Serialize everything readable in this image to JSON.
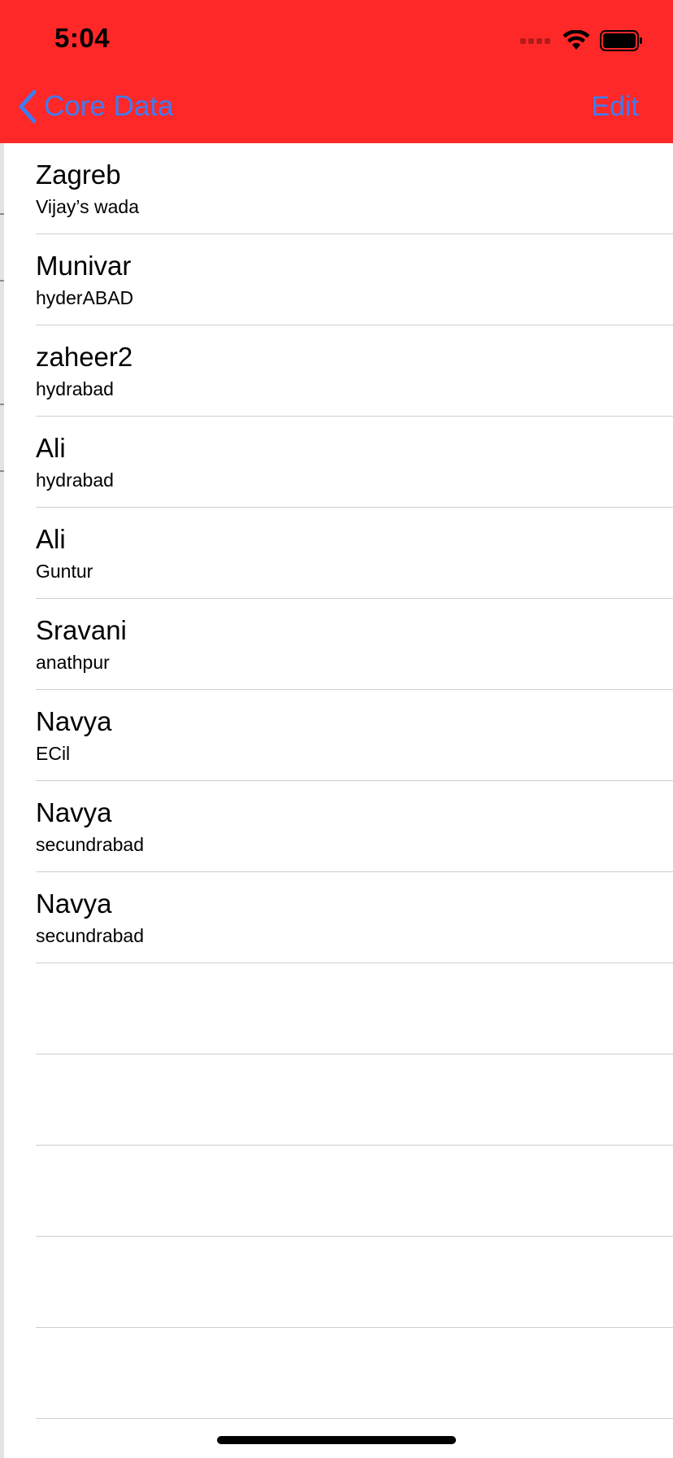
{
  "status_bar": {
    "time": "5:04"
  },
  "nav_bar": {
    "back_label": "Core Data",
    "edit_label": "Edit",
    "background_color": "#fe2828",
    "tint_color": "#3f7cf0"
  },
  "rows": [
    {
      "title": "Zagreb",
      "subtitle": "Vijay’s wada"
    },
    {
      "title": "Munivar",
      "subtitle": "hyderABAD"
    },
    {
      "title": "zaheer2",
      "subtitle": "hydrabad"
    },
    {
      "title": "Ali",
      "subtitle": "hydrabad"
    },
    {
      "title": "Ali",
      "subtitle": "Guntur"
    },
    {
      "title": "Sravani",
      "subtitle": "anathpur"
    },
    {
      "title": "Navya",
      "subtitle": "ECil"
    },
    {
      "title": "Navya",
      "subtitle": "secundrabad"
    },
    {
      "title": "Navya",
      "subtitle": "secundrabad"
    },
    {
      "title": "",
      "subtitle": ""
    },
    {
      "title": "",
      "subtitle": ""
    },
    {
      "title": "",
      "subtitle": ""
    },
    {
      "title": "",
      "subtitle": ""
    },
    {
      "title": "",
      "subtitle": ""
    }
  ]
}
